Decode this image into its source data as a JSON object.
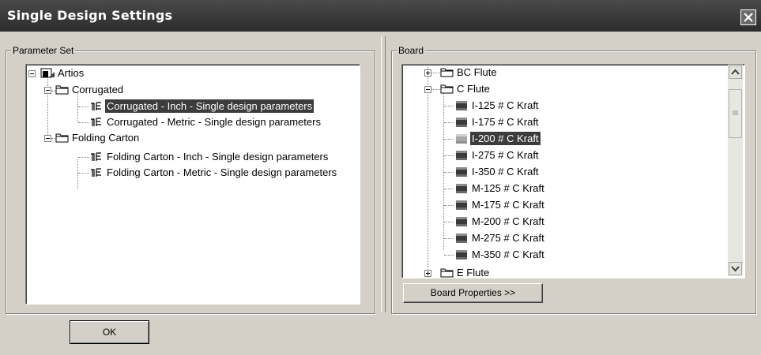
{
  "window": {
    "title": "Single Design Settings"
  },
  "parameter_set": {
    "label": "Parameter Set",
    "items": [
      {
        "label": "Artios",
        "icon": "artios-icon"
      },
      {
        "label": "Corrugated",
        "icon": "folder-icon"
      },
      {
        "label": "Corrugated - Inch - Single design parameters",
        "icon": "parameter-set-icon",
        "selected": true
      },
      {
        "label": "Corrugated - Metric - Single design parameters",
        "icon": "parameter-set-icon"
      },
      {
        "label": "Folding Carton",
        "icon": "folder-icon"
      },
      {
        "label": "Folding Carton - Inch - Single design parameters",
        "icon": "parameter-set-icon"
      },
      {
        "label": "Folding Carton - Metric - Single design parameters",
        "icon": "parameter-set-icon"
      }
    ]
  },
  "board": {
    "label": "Board",
    "items": [
      {
        "label": "BC Flute",
        "icon": "folder-icon"
      },
      {
        "label": "C Flute",
        "icon": "folder-icon"
      },
      {
        "label": "I-125 # C Kraft",
        "icon": "board-icon"
      },
      {
        "label": "I-175 # C Kraft",
        "icon": "board-icon"
      },
      {
        "label": "I-200 # C Kraft",
        "icon": "board-icon",
        "selected": true
      },
      {
        "label": "I-275 # C Kraft",
        "icon": "board-icon"
      },
      {
        "label": "I-350 # C Kraft",
        "icon": "board-icon"
      },
      {
        "label": "M-125 # C Kraft",
        "icon": "board-icon"
      },
      {
        "label": "M-175 # C Kraft",
        "icon": "board-icon"
      },
      {
        "label": "M-200 # C Kraft",
        "icon": "board-icon"
      },
      {
        "label": "M-275 # C Kraft",
        "icon": "board-icon"
      },
      {
        "label": "M-350 # C Kraft",
        "icon": "board-icon"
      },
      {
        "label": "E Flute",
        "icon": "folder-icon"
      }
    ],
    "properties_button": "Board Properties >>"
  },
  "buttons": {
    "ok": "OK"
  },
  "colors": {
    "title_bar": "#3a3a3a",
    "selection": "#3c3c3c",
    "dialog_face": "#d4d0c8"
  }
}
